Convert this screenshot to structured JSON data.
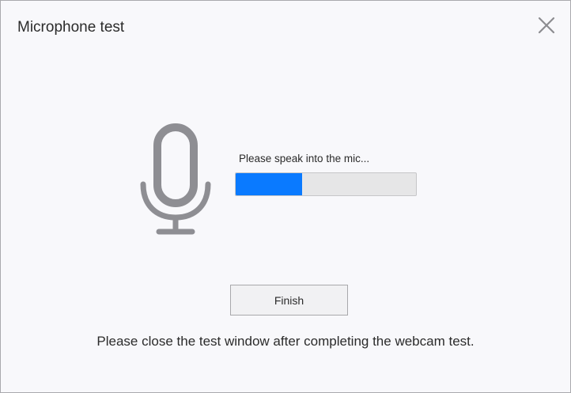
{
  "window": {
    "title": "Microphone test",
    "close_icon": "close-icon"
  },
  "mic": {
    "icon": "microphone-icon",
    "prompt": "Please speak into the mic...",
    "level_percent": 37,
    "level_color": "#0a7aff"
  },
  "actions": {
    "finish_label": "Finish"
  },
  "footer": {
    "note": "Please close the test window after completing the webcam test."
  }
}
